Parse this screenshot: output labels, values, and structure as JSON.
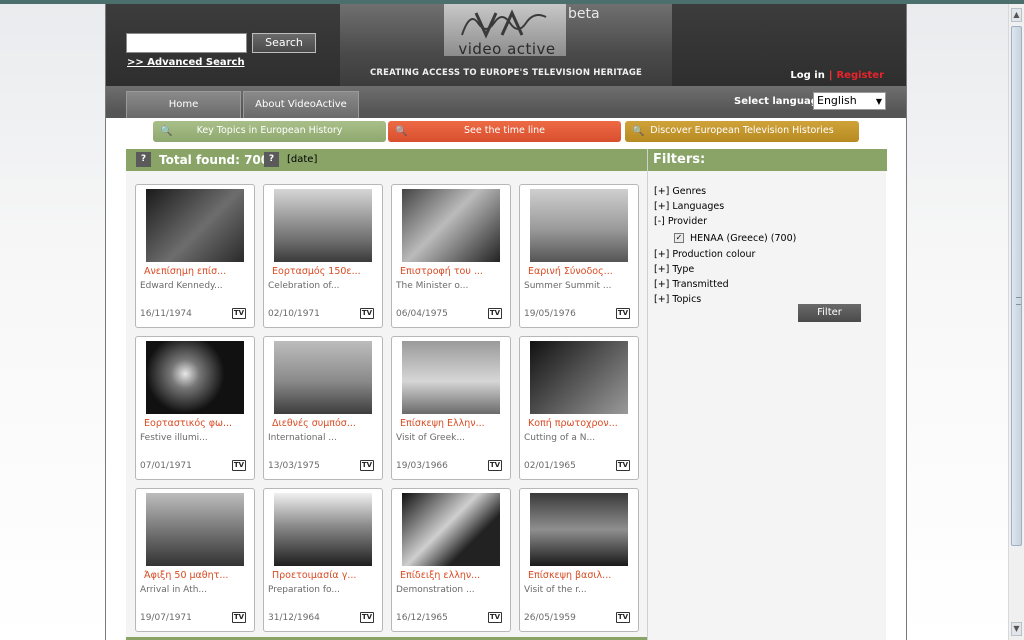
{
  "header": {
    "search_button": "Search",
    "advanced_search": ">> Advanced Search",
    "logo_text": "video active",
    "beta": "beta",
    "tagline": "CREATING ACCESS TO EUROPE'S TELEVISION HERITAGE",
    "login": "Log in",
    "separator": "|",
    "register": "Register"
  },
  "nav": {
    "tabs": [
      "Home",
      "About VideoActive"
    ],
    "language_label": "Select language :",
    "language_value": "English"
  },
  "topics": [
    {
      "label": "Key Topics in European History",
      "color": "#9bb37b"
    },
    {
      "label": "See the time line",
      "color": "#e45d3a"
    },
    {
      "label": "Discover European Television Histories",
      "color": "#c49630"
    }
  ],
  "results": {
    "help": "?",
    "total_label": "Total found: 700",
    "sort": "[date]",
    "items": [
      {
        "title": "Ανεπίσημη επίσ...",
        "subtitle": "Edward Kennedy...",
        "date": "16/11/1974",
        "badge": "TV"
      },
      {
        "title": "Εορτασμός 150ε...",
        "subtitle": "Celebration of...",
        "date": "02/10/1971",
        "badge": "TV"
      },
      {
        "title": "Επιστροφή του ...",
        "subtitle": "The Minister o...",
        "date": "06/04/1975",
        "badge": "TV"
      },
      {
        "title": "Εαρινή Σύνοδος...",
        "subtitle": "Summer Summit ...",
        "date": "19/05/1976",
        "badge": "TV"
      },
      {
        "title": "Εορταστικός φω...",
        "subtitle": "Festive illumi...",
        "date": "07/01/1971",
        "badge": "TV"
      },
      {
        "title": "Διεθνές συμπόσ...",
        "subtitle": "International ...",
        "date": "13/03/1975",
        "badge": "TV"
      },
      {
        "title": "Επίσκεψη Ελλην...",
        "subtitle": "Visit of Greek...",
        "date": "19/03/1966",
        "badge": "TV"
      },
      {
        "title": "Κοπή πρωτοχρον...",
        "subtitle": "Cutting of a N...",
        "date": "02/01/1965",
        "badge": "TV"
      },
      {
        "title": "Άφιξη 50 μαθητ...",
        "subtitle": "Arrival in Ath...",
        "date": "19/07/1971",
        "badge": "TV"
      },
      {
        "title": "Προετοιμασία γ...",
        "subtitle": "Preparation fo...",
        "date": "31/12/1964",
        "badge": "TV"
      },
      {
        "title": "Επίδειξη ελλην...",
        "subtitle": "Demonstration ...",
        "date": "16/12/1965",
        "badge": "TV"
      },
      {
        "title": "Επίσκεψη βασιλ...",
        "subtitle": "Visit of the r...",
        "date": "26/05/1959",
        "badge": "TV"
      }
    ]
  },
  "filters": {
    "title": "Filters:",
    "items": [
      "[+] Genres",
      "[+] Languages",
      "[-] Provider",
      "[+] Production colour",
      "[+] Type",
      "[+] Transmitted",
      "[+] Topics"
    ],
    "provider_option": "HENAA (Greece) (700)",
    "provider_checked": true,
    "button": "Filter"
  },
  "colors": {
    "accent_green": "#8aa468",
    "accent_red": "#d94a22"
  }
}
